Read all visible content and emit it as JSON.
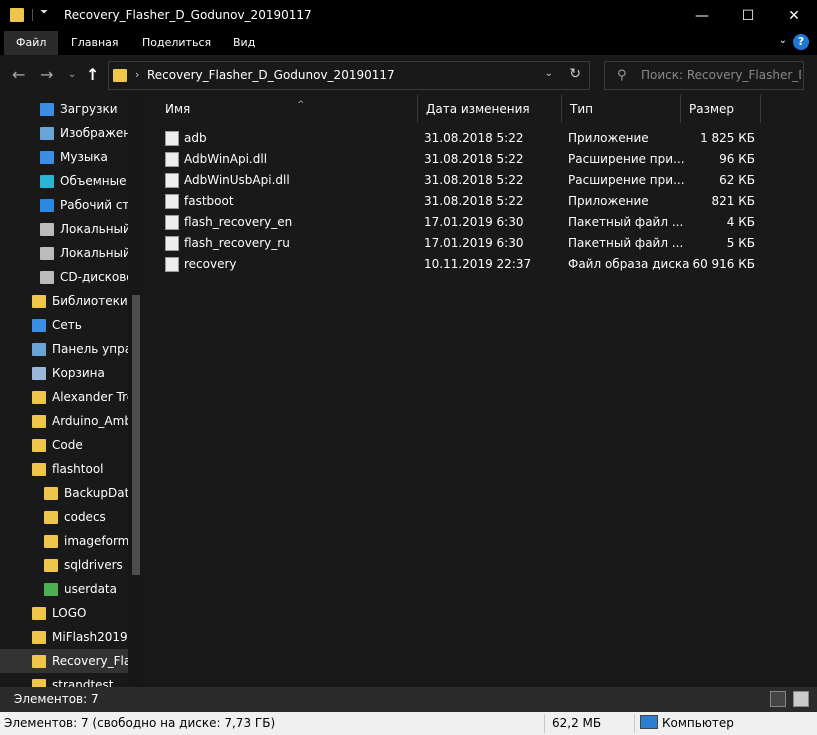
{
  "window": {
    "title": "Recovery_Flasher_D_Godunov_20190117",
    "minimize_glyph": "—",
    "maximize_glyph": "☐",
    "close_glyph": "✕"
  },
  "ribbon": {
    "tabs": [
      "Файл",
      "Главная",
      "Поделиться",
      "Вид"
    ],
    "help_glyph": "?"
  },
  "address": {
    "path": "Recovery_Flasher_D_Godunov_20190117",
    "search_placeholder": "Поиск: Recovery_Flasher_D..."
  },
  "sidebar": {
    "items": [
      {
        "label": "Загрузки",
        "icon": "download-icon",
        "color": "#3b8ee6"
      },
      {
        "label": "Изображен",
        "icon": "pictures-icon",
        "color": "#6aa3d6"
      },
      {
        "label": "Музыка",
        "icon": "music-icon",
        "color": "#3b8ee6"
      },
      {
        "label": "Объемные",
        "icon": "3d-objects-icon",
        "color": "#29b6d6"
      },
      {
        "label": "Рабочий ст",
        "icon": "desktop-icon",
        "color": "#2a8ae2"
      },
      {
        "label": "Локальный",
        "icon": "drive-icon",
        "color": "#bbbbbb"
      },
      {
        "label": "Локальный",
        "icon": "drive-icon",
        "color": "#bbbbbb"
      },
      {
        "label": "CD-дисково",
        "icon": "cd-drive-icon",
        "color": "#bbbbbb"
      },
      {
        "label": "Библиотеки",
        "icon": "libraries-icon",
        "color": "#f0c54b"
      },
      {
        "label": "Сеть",
        "icon": "network-icon",
        "color": "#3b8ee6"
      },
      {
        "label": "Панель упра",
        "icon": "control-panel-icon",
        "color": "#6aa3d6"
      },
      {
        "label": "Корзина",
        "icon": "recycle-bin-icon",
        "color": "#9bb8d8"
      },
      {
        "label": "Alexander Tre",
        "icon": "folder-icon",
        "color": "#f0c54b"
      },
      {
        "label": "Arduino_Amb",
        "icon": "folder-icon",
        "color": "#f0c54b"
      },
      {
        "label": "Code",
        "icon": "folder-icon",
        "color": "#f0c54b"
      },
      {
        "label": "flashtool",
        "icon": "folder-icon",
        "color": "#f0c54b"
      },
      {
        "label": "BackupData",
        "icon": "folder-icon",
        "color": "#f0c54b"
      },
      {
        "label": "codecs",
        "icon": "folder-icon",
        "color": "#f0c54b"
      },
      {
        "label": "imageforma",
        "icon": "folder-icon",
        "color": "#f0c54b"
      },
      {
        "label": "sqldrivers",
        "icon": "folder-icon",
        "color": "#f0c54b"
      },
      {
        "label": "userdata",
        "icon": "folder-icon",
        "color": "#4caf50"
      },
      {
        "label": "LOGO",
        "icon": "folder-icon",
        "color": "#f0c54b"
      },
      {
        "label": "MiFlash20191",
        "icon": "folder-icon",
        "color": "#f0c54b"
      },
      {
        "label": "Recovery_Flas",
        "icon": "folder-icon",
        "color": "#f0c54b"
      },
      {
        "label": "strandtest",
        "icon": "folder-icon",
        "color": "#f0c54b"
      }
    ]
  },
  "columns": {
    "name": "Имя",
    "date": "Дата изменения",
    "type": "Тип",
    "size": "Размер"
  },
  "files": [
    {
      "name": "adb",
      "date": "31.08.2018 5:22",
      "type": "Приложение",
      "size": "1 825 КБ",
      "icon": "app-icon"
    },
    {
      "name": "AdbWinApi.dll",
      "date": "31.08.2018 5:22",
      "type": "Расширение при...",
      "size": "96 КБ",
      "icon": "dll-icon"
    },
    {
      "name": "AdbWinUsbApi.dll",
      "date": "31.08.2018 5:22",
      "type": "Расширение при...",
      "size": "62 КБ",
      "icon": "dll-icon"
    },
    {
      "name": "fastboot",
      "date": "31.08.2018 5:22",
      "type": "Приложение",
      "size": "821 КБ",
      "icon": "app-icon"
    },
    {
      "name": "flash_recovery_en",
      "date": "17.01.2019 6:30",
      "type": "Пакетный файл ...",
      "size": "4 КБ",
      "icon": "batch-file-icon"
    },
    {
      "name": "flash_recovery_ru",
      "date": "17.01.2019 6:30",
      "type": "Пакетный файл ...",
      "size": "5 КБ",
      "icon": "batch-file-icon"
    },
    {
      "name": "recovery",
      "date": "10.11.2019 22:37",
      "type": "Файл образа диска",
      "size": "60 916 КБ",
      "icon": "disk-image-icon"
    }
  ],
  "status": {
    "items_count": "Элементов: 7",
    "bottom_info": "Элементов: 7 (свободно на диске: 7,73 ГБ)",
    "size": "62,2 МБ",
    "location": "Компьютер"
  }
}
